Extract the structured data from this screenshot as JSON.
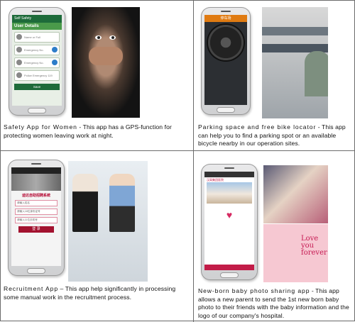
{
  "cells": [
    {
      "caption_lead": "Safety App for Women",
      "caption_rest": " - This app has a GPS-function for protecting women leaving work at night.",
      "phone": {
        "status": "Self Safety",
        "title": "User Details",
        "fields": [
          "Name or Full",
          "Emergency No.",
          "Emergency No.",
          "Police Emergency 119"
        ],
        "button": "Save"
      }
    },
    {
      "caption_lead": "Parking space and free bike locator",
      "caption_rest": " - This app can help you to find a parking spot or an available bicycle nearby in our operation sites.",
      "phone": {
        "status": "停车场"
      }
    },
    {
      "caption_lead": "Recruitment App",
      "caption_rest": " – This app help significantly in processing some manual work in the recruitment process.",
      "phone": {
        "title": "迪达自助招聘系统",
        "fields": [
          "请输入姓名",
          "请输入18位身份证号",
          "请输入11位手机号"
        ],
        "button": "登 录"
      }
    },
    {
      "caption_lead": "New-born baby photo sharing app",
      "caption_rest": " - This app allows a new parent to send the 1st new born baby photo to their friends with the baby information and the logo of our company's hospital.",
      "phone": {
        "header": "汉高集团医院"
      },
      "photo_text": "Love you forever"
    }
  ]
}
